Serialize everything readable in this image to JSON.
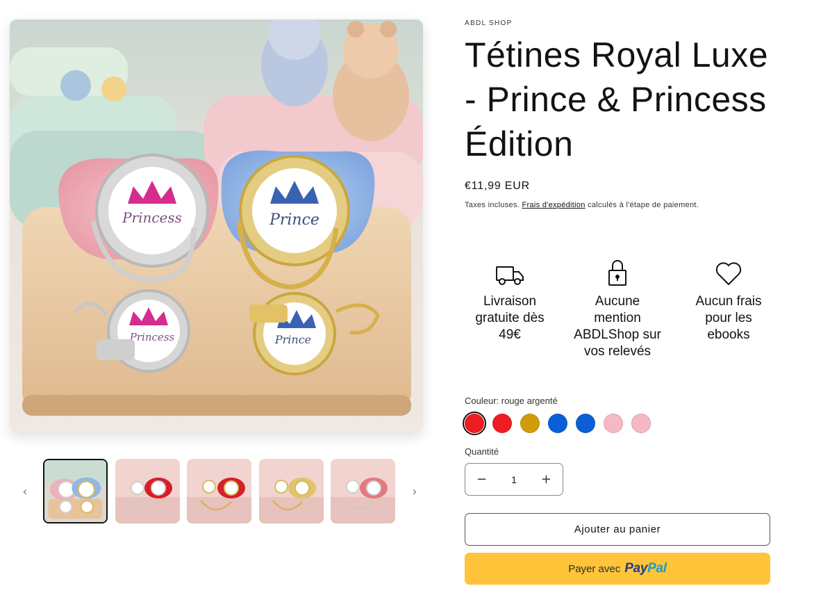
{
  "product": {
    "vendor": "ABDL SHOP",
    "title": "Tétines Royal Luxe - Prince & Princess Édition",
    "price": "€11,99 EUR",
    "taxes_prefix": "Taxes incluses.",
    "taxes_link": "Frais d'expédition",
    "taxes_suffix": "calculés à l'étape de paiement."
  },
  "gallery": {
    "main_image": {
      "pacifier_labels": [
        "Princess",
        "Prince"
      ],
      "clip_labels": [
        "Princess",
        "Prince"
      ]
    },
    "thumbnail_count": 5,
    "active_thumbnail": 1
  },
  "features": [
    {
      "icon": "truck-icon",
      "label": "Livraison gratuite dès 49€"
    },
    {
      "icon": "lock-icon",
      "label": "Aucune mention ABDLShop sur vos relevés"
    },
    {
      "icon": "heart-icon",
      "label": "Aucun frais pour les ebooks"
    }
  ],
  "color": {
    "label": "Couleur: rouge argenté",
    "swatches": [
      "#ee1d23",
      "#ee1d23",
      "#d19c0a",
      "#0b5fd6",
      "#0b5fd6",
      "#f6b8c4",
      "#f6b8c4"
    ],
    "selected_index": 0
  },
  "quantity": {
    "label": "Quantité",
    "value": "1",
    "minus": "−",
    "plus": "+"
  },
  "buttons": {
    "add_to_cart": "Ajouter au panier",
    "paypal_prefix": "Payer avec",
    "paypal_brand_1": "Pay",
    "paypal_brand_2": "Pal"
  },
  "nav": {
    "prev": "‹",
    "next": "›"
  }
}
